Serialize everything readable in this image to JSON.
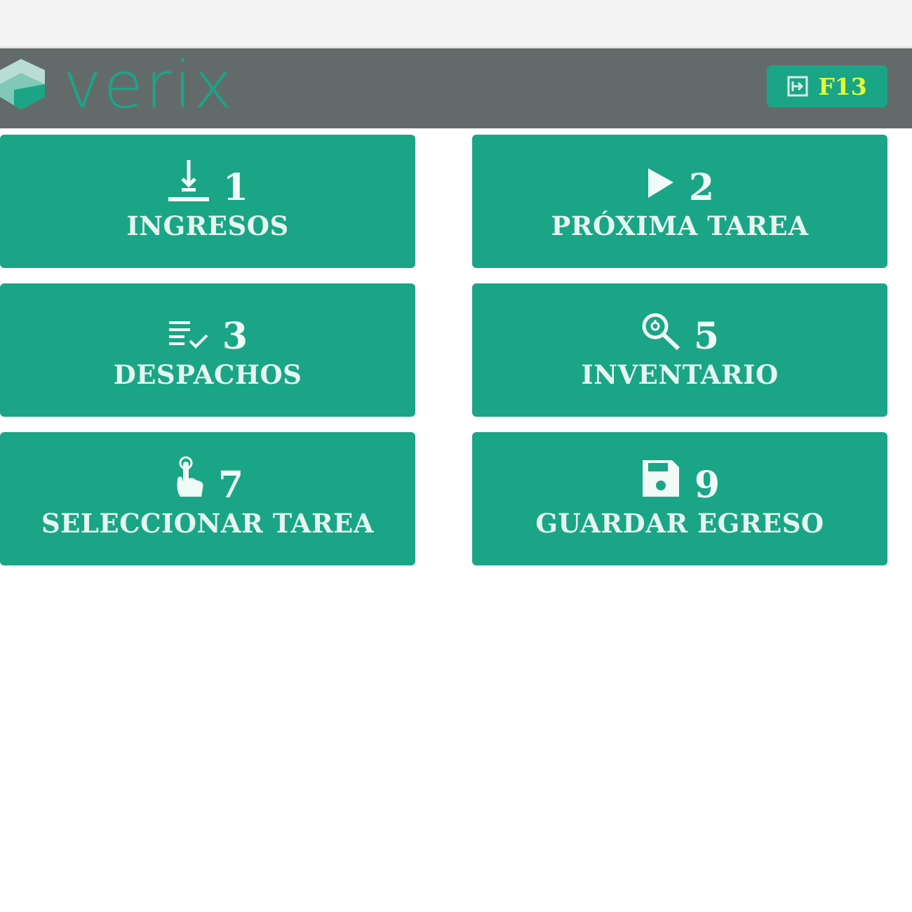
{
  "header": {
    "logo_text": "verix",
    "f13_button": {
      "label": "F13",
      "icon": "exit-icon"
    }
  },
  "colors": {
    "header_bg": "#636b6a",
    "accent": "#1aa586",
    "f13_text": "#e8ff30",
    "tile_text": "#e6f5f0"
  },
  "tiles": [
    {
      "number": "1",
      "label": "INGRESOS",
      "icon": "download-tray-icon"
    },
    {
      "number": "2",
      "label": "PRÓXIMA TAREA",
      "icon": "play-icon"
    },
    {
      "number": "3",
      "label": "DESPACHOS",
      "icon": "list-check-icon"
    },
    {
      "number": "5",
      "label": "INVENTARIO",
      "icon": "search-icon"
    },
    {
      "number": "7",
      "label": "SELECCIONAR TAREA",
      "icon": "hand-pointer-icon"
    },
    {
      "number": "9",
      "label": "GUARDAR EGRESO",
      "icon": "save-icon"
    }
  ]
}
